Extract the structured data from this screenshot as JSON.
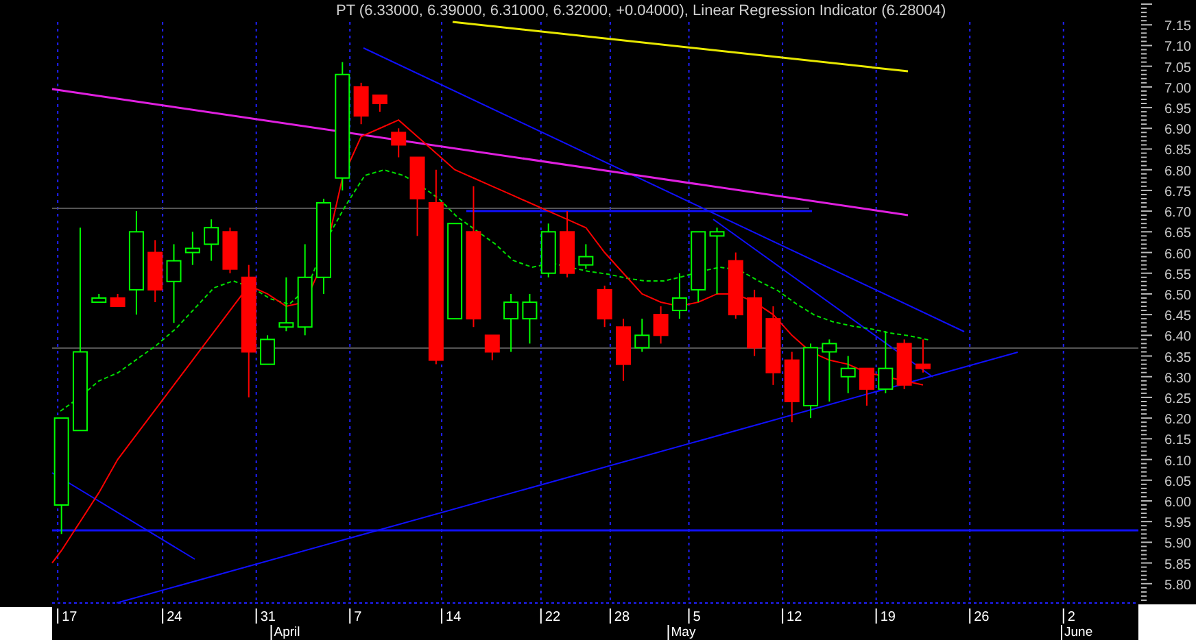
{
  "chart": {
    "title": "PT (6.33000, 6.39000, 6.31000, 6.32000, +0.04000), Linear Regression Indicator (6.28004)",
    "y_axis_labels": [
      "7.15",
      "7.10",
      "7.05",
      "7.00",
      "6.95",
      "6.90",
      "6.85",
      "6.80",
      "6.75",
      "6.70",
      "6.65",
      "6.60",
      "6.55",
      "6.50",
      "6.45",
      "6.40",
      "6.35",
      "6.30",
      "6.25",
      "6.20",
      "6.15",
      "6.10",
      "6.05",
      "6.00",
      "5.95",
      "5.90",
      "5.85",
      "5.80"
    ],
    "x_axis_labels": [
      "17",
      "24",
      "31",
      "7",
      "14",
      "22",
      "28",
      "5",
      "12",
      "19",
      "26",
      "2"
    ],
    "month_labels": [
      "April",
      "May",
      "June"
    ]
  }
}
